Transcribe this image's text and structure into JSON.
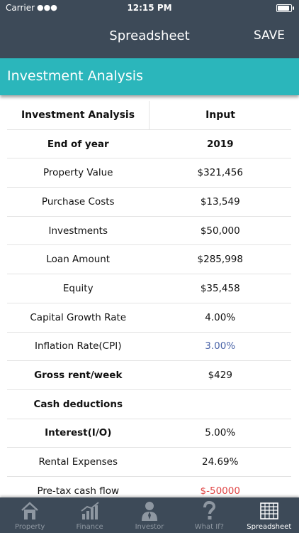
{
  "status": {
    "carrier": "Carrier",
    "time": "12:15 PM"
  },
  "nav": {
    "title": "Spreadsheet",
    "save": "SAVE"
  },
  "section": {
    "title": "Investment Analysis"
  },
  "table": {
    "headers": [
      "Investment Analysis",
      "Input"
    ],
    "rows": [
      {
        "label": "End of year",
        "value": "2019"
      },
      {
        "label": "Property Value",
        "value": "$321,456"
      },
      {
        "label": "Purchase Costs",
        "value": "$13,549"
      },
      {
        "label": "Investments",
        "value": "$50,000"
      },
      {
        "label": "Loan Amount",
        "value": "$285,998"
      },
      {
        "label": "Equity",
        "value": "$35,458"
      },
      {
        "label": "Capital Growth Rate",
        "value": "4.00%"
      },
      {
        "label": "Inflation Rate(CPI)",
        "value": "3.00%"
      },
      {
        "label": "Gross rent/week",
        "value": "$429"
      },
      {
        "label": "Cash deductions",
        "value": ""
      },
      {
        "label": "Interest(I/O)",
        "value": "5.00%"
      },
      {
        "label": "Rental Expenses",
        "value": "24.69%"
      },
      {
        "label": "Pre-tax cash flow",
        "value": "$-50000"
      }
    ]
  },
  "tabs": [
    {
      "label": "Property",
      "icon": "house-icon"
    },
    {
      "label": "Finance",
      "icon": "bar-chart-icon"
    },
    {
      "label": "Investor",
      "icon": "person-icon"
    },
    {
      "label": "What If?",
      "icon": "question-icon"
    },
    {
      "label": "Spreadsheet",
      "icon": "spreadsheet-icon"
    }
  ],
  "colors": {
    "bar": "#3d4a58",
    "accent": "#2bb6bb",
    "blue_value": "#4a64a8",
    "negative": "#e04545"
  }
}
